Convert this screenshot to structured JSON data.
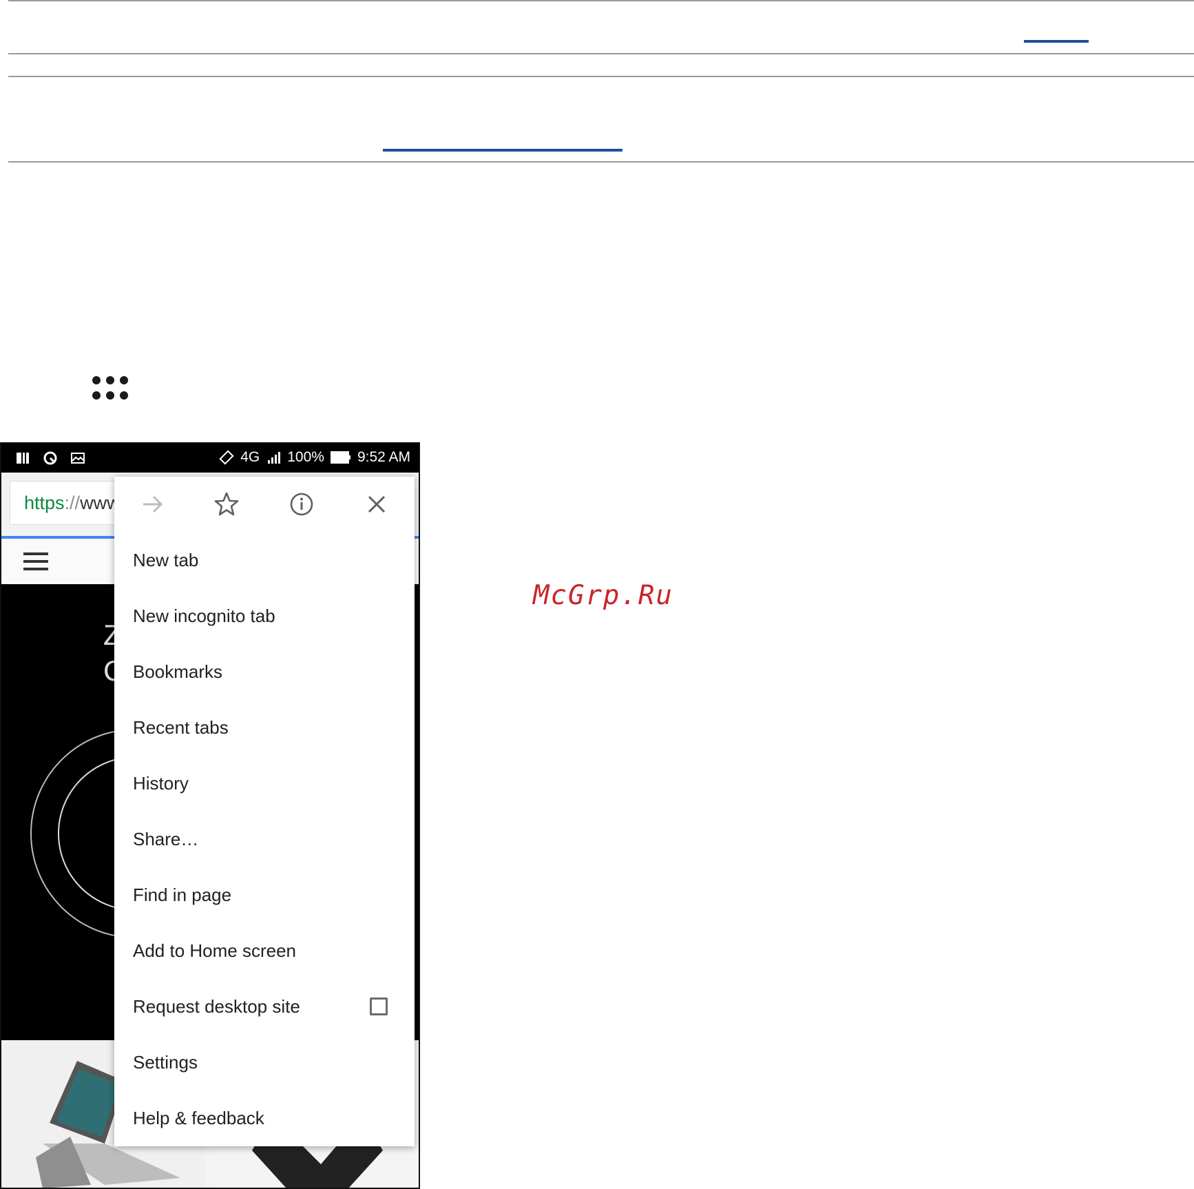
{
  "watermark": "McGrp.Ru",
  "status_bar": {
    "network": "4G",
    "battery": "100%",
    "time": "9:52 AM",
    "icons": [
      "notification-book-icon",
      "speedometer-icon",
      "image-icon",
      "vibrate-icon",
      "signal-icon",
      "battery-icon"
    ]
  },
  "browser": {
    "url_scheme": "https",
    "url_separator": "://",
    "url_rest": "www.asus.com",
    "hero_letters": [
      "Z",
      "C"
    ]
  },
  "menu": {
    "top_icons": [
      "forward-arrow-icon",
      "star-icon",
      "info-icon",
      "close-icon"
    ],
    "items": [
      {
        "label": "New tab"
      },
      {
        "label": "New incognito tab"
      },
      {
        "label": "Bookmarks"
      },
      {
        "label": "Recent tabs"
      },
      {
        "label": "History"
      },
      {
        "label": "Share…"
      },
      {
        "label": "Find in page"
      },
      {
        "label": "Add to Home screen"
      },
      {
        "label": "Request desktop site",
        "checkbox": false
      },
      {
        "label": "Settings"
      },
      {
        "label": "Help & feedback"
      }
    ]
  },
  "colors": {
    "accent_rule": "#1e4f97",
    "watermark": "#c9252b",
    "url_scheme": "#0a8a3c"
  }
}
